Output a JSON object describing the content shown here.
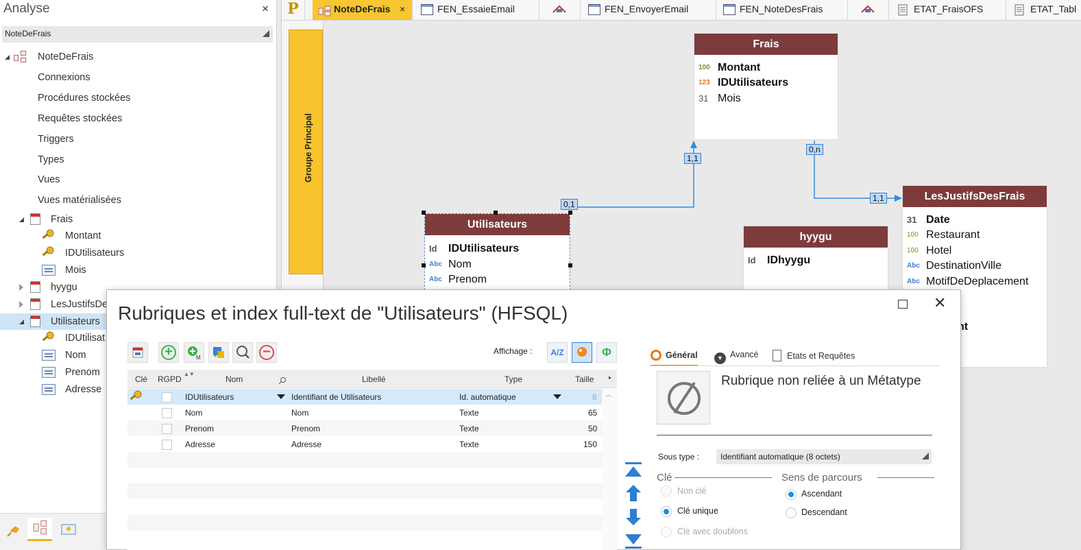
{
  "left_panel": {
    "title": "Analyse",
    "close": "×",
    "analysis_select": "NoteDeFrais",
    "tree": {
      "root": "NoteDeFrais",
      "connexions": "Connexions",
      "procedures": "Procédures stockées",
      "requetes": "Requêtes stockées",
      "triggers": "Triggers",
      "types": "Types",
      "vues": "Vues",
      "vues_mat": "Vues matérialisées",
      "frais": "Frais",
      "frais_fields": [
        "Montant",
        "IDUtilisateurs",
        "Mois"
      ],
      "hyygu": "hyygu",
      "justifs": "LesJustifsDe",
      "utilisateurs": "Utilisateurs",
      "util_fields": [
        "IDUtilisat",
        "Nom",
        "Prenom",
        "Adresse"
      ]
    }
  },
  "tabs": {
    "p_label": "P",
    "items": [
      "NoteDeFrais",
      "FEN_EssaieEmail",
      "FEN_EnvoyerEmail",
      "FEN_NoteDesFrais",
      "ETAT_FraisOFS",
      "ETAT_Tabl"
    ],
    "active_close": "×"
  },
  "canvas": {
    "groupe": "Groupe Principal",
    "frais": {
      "title": "Frais",
      "fields": [
        "Montant",
        "IDUtilisateurs",
        "Mois"
      ]
    },
    "utilisateurs": {
      "title": "Utilisateurs",
      "fields": [
        "IDUtilisateurs",
        "Nom",
        "Prenom"
      ]
    },
    "hyygu": {
      "title": "hyygu",
      "fields": [
        "IDhyygu"
      ]
    },
    "justifs": {
      "title": "LesJustifsDesFrais",
      "fields": [
        "Date",
        "Restaurant",
        "Hotel",
        "DestinationVille",
        "MotifDeDeplacement"
      ],
      "partial": "nt"
    },
    "cardinalities": {
      "util_side": "0,1",
      "frais_side": "1,1",
      "frais_bottom": "0,n",
      "justifs_side": "1,1"
    },
    "icon_text": {
      "num100": "100",
      "num123": "123",
      "cal31": "31",
      "abc": "Abc",
      "id": "Id"
    }
  },
  "dialog": {
    "title": "Rubriques et index full-text de \"Utilisateurs\" (HFSQL)",
    "close": "✕",
    "affichage_label": "Affichage :",
    "aff_buttons": [
      "A/Z",
      "Φ"
    ],
    "columns": [
      "Clé",
      "RGPD",
      "Nom",
      "Libellé",
      "Type",
      "Taille"
    ],
    "rows": [
      {
        "nom": "IDUtilisateurs",
        "libelle": "Identifiant de Utilisateurs",
        "type": "Id. automatique",
        "taille": "8"
      },
      {
        "nom": "Nom",
        "libelle": "Nom",
        "type": "Texte",
        "taille": "65"
      },
      {
        "nom": "Prenom",
        "libelle": "Prenom",
        "type": "Texte",
        "taille": "50"
      },
      {
        "nom": "Adresse",
        "libelle": "Adresse",
        "type": "Texte",
        "taille": "150"
      }
    ],
    "right_tabs": [
      "Général",
      "Avancé",
      "Etats et Requêtes"
    ],
    "no_metatype": "Rubrique non reliée à un Métatype",
    "sous_type_label": "Sous type :",
    "sous_type_value": "Identifiant automatique (8 octets)",
    "cle_title": "Clé",
    "cle_options": [
      "Non clé",
      "Clé unique",
      "Clé avec doublons"
    ],
    "cle_selected": "Clé unique",
    "sens_title": "Sens de parcours",
    "sens_options": [
      "Ascendant",
      "Descendant"
    ],
    "sens_selected": "Ascendant"
  },
  "colors": {
    "accent": "#f8c630",
    "entity_header": "#7e3b3b",
    "link": "#2a8de0",
    "selection": "#cde5f7"
  }
}
